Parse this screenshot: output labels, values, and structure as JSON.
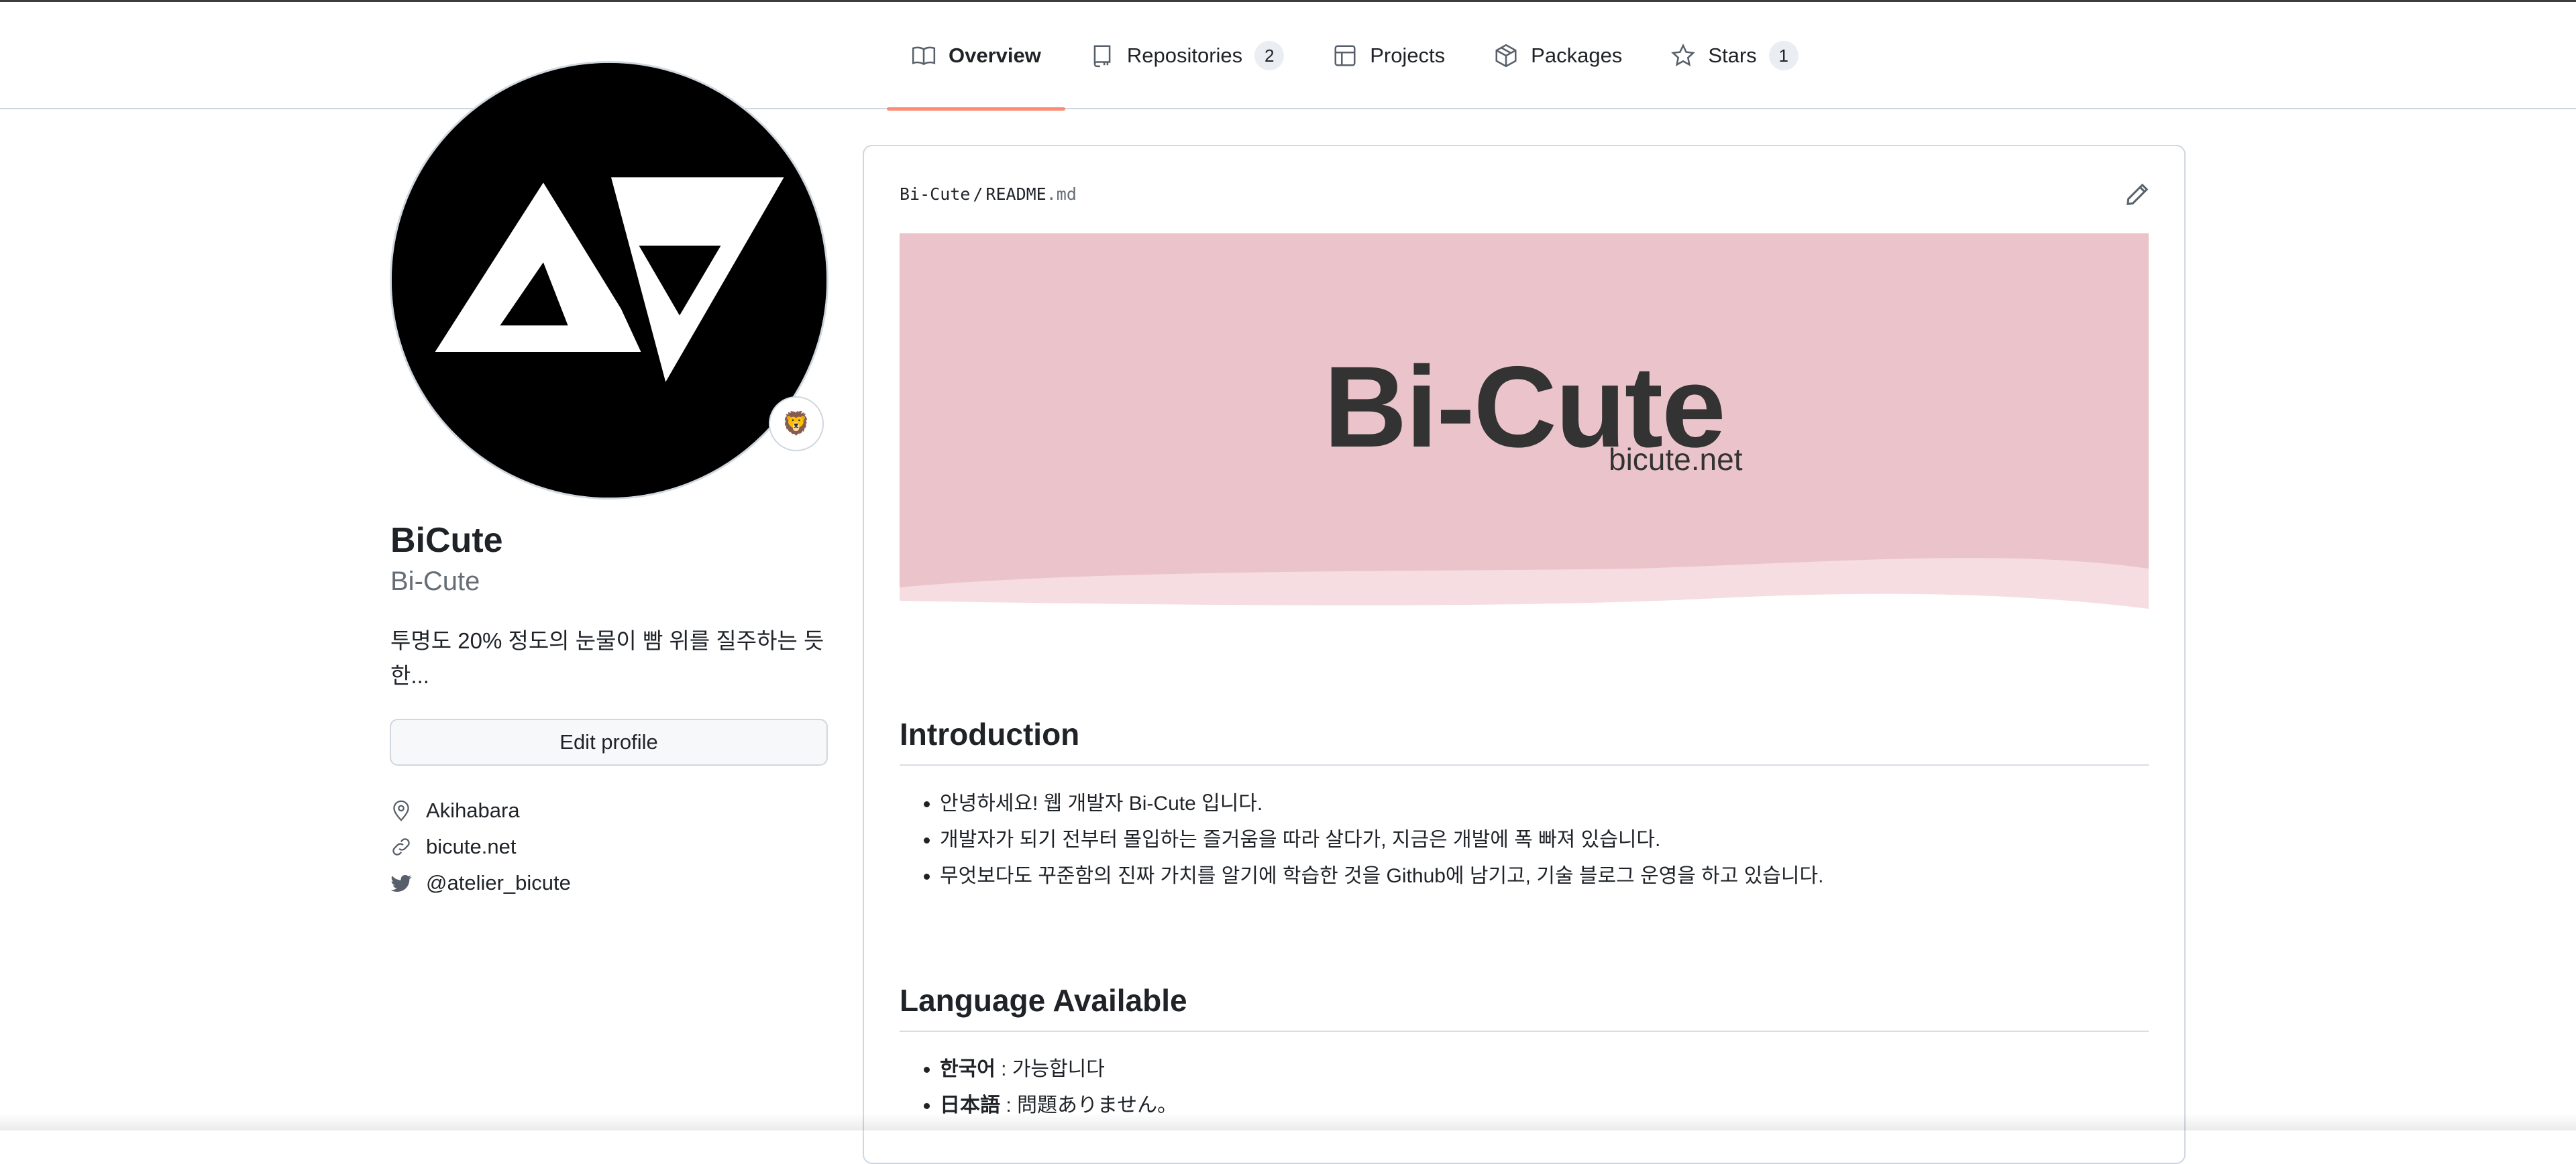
{
  "nav": {
    "tabs": [
      {
        "label": "Overview",
        "icon": "book-icon",
        "selected": true
      },
      {
        "label": "Repositories",
        "icon": "repo-icon",
        "count": "2"
      },
      {
        "label": "Projects",
        "icon": "table-icon"
      },
      {
        "label": "Packages",
        "icon": "package-icon"
      },
      {
        "label": "Stars",
        "icon": "star-icon",
        "count": "1"
      }
    ]
  },
  "profile": {
    "name": "BiCute",
    "login": "Bi-Cute",
    "status_emoji": "🦁",
    "bio": "투명도 20% 정도의 눈물이 빰 위를 질주하는 듯 한...",
    "edit_button": "Edit profile",
    "location": "Akihabara",
    "website": "bicute.net",
    "twitter": "@atelier_bicute"
  },
  "readme": {
    "owner": "Bi-Cute",
    "separator": "/",
    "file_base": "README",
    "file_ext": ".md",
    "banner": {
      "title": "Bi-Cute",
      "subtitle": "bicute.net",
      "color": "#ebc4cb"
    },
    "introduction": {
      "heading": "Introduction",
      "items": [
        "안녕하세요! 웹 개발자 Bi-Cute 입니다.",
        "개발자가 되기 전부터 몰입하는 즐거움을 따라 살다가, 지금은 개발에 폭 빠져 있습니다.",
        "무엇보다도 꾸준함의 진짜 가치를 알기에 학습한 것을 Github에 남기고, 기술 블로그 운영을 하고 있습니다."
      ]
    },
    "languages": {
      "heading": "Language Available",
      "items": [
        {
          "lang": "한국어",
          "text": " : 가능합니다"
        },
        {
          "lang": "日本語",
          "text": " : 問題ありません。"
        }
      ]
    }
  },
  "colors": {
    "tab_underline": "#fd8c73",
    "border": "#d0d7de",
    "muted_text": "#656d76",
    "banner_pink": "#ebc4cb",
    "banner_wave": "#f5dde1"
  }
}
